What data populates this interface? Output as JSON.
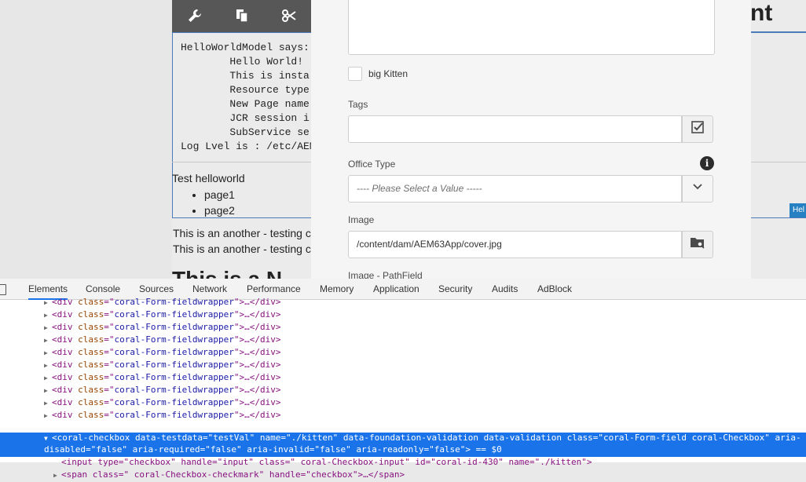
{
  "page": {
    "toolbar_icons": [
      "wrench-icon",
      "copy-icon",
      "cut-icon"
    ],
    "heading_right": "nt",
    "log_lines": [
      "HelloWorldModel says:",
      "        Hello World!",
      "        This is insta",
      "        Resource type",
      "        New Page name",
      "        JCR session i",
      "        SubService se",
      "Log Lvel is : /etc/AEM"
    ],
    "test_helloworld": "Test helloworld",
    "pages": [
      "page1",
      "page2"
    ],
    "hel_tag": "Hel",
    "another_1": "This is an another - testing c",
    "another_2": "This is an another - testing c",
    "big_heading": "This is a N"
  },
  "dialog": {
    "checkbox_label": "big Kitten",
    "tags_label": "Tags",
    "office_type_label": "Office Type",
    "office_type_placeholder": "----  Please Select a Value -----",
    "image_label": "Image",
    "image_value": "/content/dam/AEM63App/cover.jpg",
    "image_pathfield_label": "Image - PathField"
  },
  "devtools": {
    "tabs": [
      "Elements",
      "Console",
      "Sources",
      "Network",
      "Performance",
      "Memory",
      "Application",
      "Security",
      "Audits",
      "AdBlock"
    ],
    "active_tab": "Elements",
    "fieldwrapper_tag": "div",
    "fieldwrapper_class": "coral-Form-fieldwrapper",
    "ellipsis": "…",
    "selected_line_1": "<coral-checkbox data-testdata=\"testVal\" name=\"./kitten\" data-foundation-validation data-validation class=\"coral-Form-field coral-Checkbox\" aria-",
    "selected_line_2": "disabled=\"false\" aria-required=\"false\" aria-invalid=\"false\" aria-readonly=\"false\"> == $0",
    "input_line": "<input type=\"checkbox\" handle=\"input\" class=\" coral-Checkbox-input\" id=\"coral-id-430\" name=\"./kitten\">",
    "span_line": "<span class=\" coral-Checkbox-checkmark\" handle=\"checkbox\">…</span>"
  }
}
